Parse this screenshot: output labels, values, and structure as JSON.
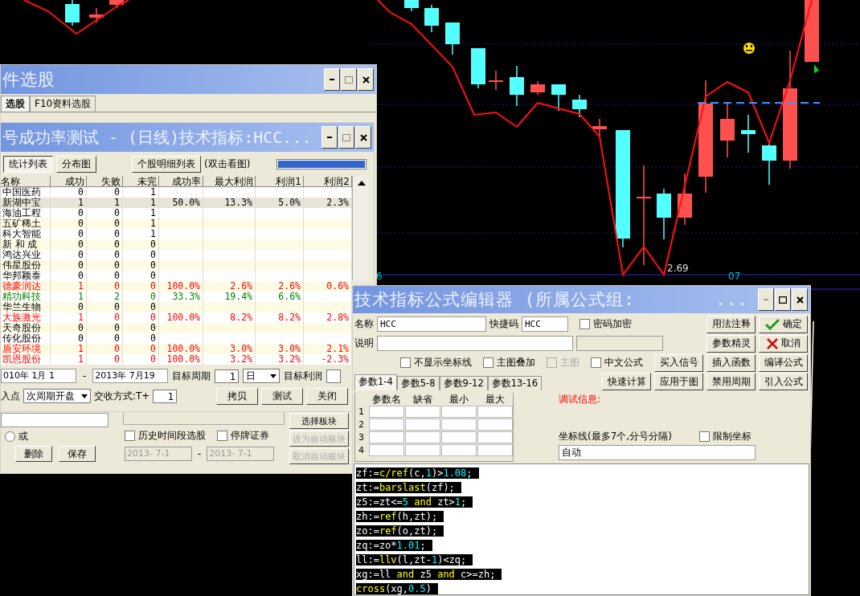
{
  "chart": {
    "price_label": "2.69",
    "axis_labels": [
      "6",
      "07"
    ]
  },
  "selector_window": {
    "title": "件选股",
    "tabs": [
      {
        "label": "选股",
        "selected": true
      },
      {
        "label": "F10资料选股",
        "selected": false
      }
    ],
    "radio": {
      "label": "或",
      "selected": false
    },
    "buttons": [
      "删除",
      "保存"
    ],
    "checkboxes": [
      {
        "label": "历史时间段选股",
        "checked": false
      },
      {
        "label": "停牌证券",
        "checked": false
      }
    ],
    "date_from": "2013- 7-1",
    "date_sep": "-",
    "date_to": "2013- 7-1",
    "block_buttons": [
      {
        "label": "选择板块",
        "disabled": false
      },
      {
        "label": "设为自动板块",
        "disabled": true
      },
      {
        "label": "取消自动板块",
        "disabled": true
      }
    ]
  },
  "test_window": {
    "title": "号成功率测试 - (日线)技术指标:HCC...",
    "view_buttons": [
      {
        "label": "统计列表",
        "selected": true
      },
      {
        "label": "分布图",
        "selected": false
      }
    ],
    "detail_button": "个股明细列表",
    "hint": "(双击看图)",
    "progress": {
      "level": 1
    },
    "columns": [
      "名称",
      "成功",
      "失败",
      "未完",
      "成功率",
      "最大利润",
      "利润1",
      "利润2"
    ],
    "rows": [
      {
        "cells": [
          "中国医药",
          "0",
          "0",
          "1",
          "",
          "",
          "",
          ""
        ],
        "color": "#000000",
        "selected": false
      },
      {
        "cells": [
          "新湖中宝",
          "1",
          "1",
          "1",
          "50.0%",
          "13.3%",
          "5.0%",
          "2.3%"
        ],
        "color": "#000000",
        "selected": true
      },
      {
        "cells": [
          "海油工程",
          "0",
          "0",
          "1",
          "",
          "",
          "",
          ""
        ],
        "color": "#000000",
        "selected": false
      },
      {
        "cells": [
          "五矿稀土",
          "0",
          "0",
          "1",
          "",
          "",
          "",
          ""
        ],
        "color": "#000000",
        "selected": false
      },
      {
        "cells": [
          "科大智能",
          "0",
          "0",
          "1",
          "",
          "",
          "",
          ""
        ],
        "color": "#000000",
        "selected": false
      },
      {
        "cells": [
          "新 和 成",
          "0",
          "0",
          "0",
          "",
          "",
          "",
          ""
        ],
        "color": "#000000",
        "selected": false
      },
      {
        "cells": [
          "鸿达兴业",
          "0",
          "0",
          "0",
          "",
          "",
          "",
          ""
        ],
        "color": "#000000",
        "selected": false
      },
      {
        "cells": [
          "伟星股份",
          "0",
          "0",
          "0",
          "",
          "",
          "",
          ""
        ],
        "color": "#000000",
        "selected": false
      },
      {
        "cells": [
          "华邦颖泰",
          "0",
          "0",
          "0",
          "",
          "",
          "",
          ""
        ],
        "color": "#000000",
        "selected": false
      },
      {
        "cells": [
          "德豪润达",
          "1",
          "0",
          "0",
          "100.0%",
          "2.6%",
          "2.6%",
          "0.6%"
        ],
        "color": "#ff0000",
        "selected": false
      },
      {
        "cells": [
          "精功科技",
          "1",
          "2",
          "0",
          "33.3%",
          "19.4%",
          "6.6%",
          ""
        ],
        "color": "#008000",
        "selected": false
      },
      {
        "cells": [
          "华兰生物",
          "0",
          "0",
          "0",
          "",
          "",
          "",
          ""
        ],
        "color": "#000000",
        "selected": false
      },
      {
        "cells": [
          "大族激光",
          "1",
          "0",
          "0",
          "100.0%",
          "8.2%",
          "8.2%",
          "2.8%"
        ],
        "color": "#ff0000",
        "selected": false
      },
      {
        "cells": [
          "天奇股份",
          "0",
          "0",
          "0",
          "",
          "",
          "",
          ""
        ],
        "color": "#000000",
        "selected": false
      },
      {
        "cells": [
          "传化股份",
          "0",
          "0",
          "0",
          "",
          "",
          "",
          ""
        ],
        "color": "#000000",
        "selected": false
      },
      {
        "cells": [
          "盾安环境",
          "1",
          "0",
          "0",
          "100.0%",
          "3.0%",
          "3.0%",
          "2.1%"
        ],
        "color": "#ff0000",
        "selected": false
      },
      {
        "cells": [
          "凯恩股份",
          "1",
          "0",
          "0",
          "100.0%",
          "3.2%",
          "3.2%",
          "-2.3%"
        ],
        "color": "#ff0000",
        "selected": false
      }
    ],
    "date_from": "010年 1月 1",
    "date_sep": "-",
    "date_to": "2013年 7月19",
    "period_label": "目标周期",
    "period_value": "1",
    "period_unit": "日",
    "profit_label": "目标利润",
    "entry_label": "入点",
    "entry_value": "次周期开盘",
    "settle_label": "交收方式:T+",
    "settle_value": "1",
    "action_buttons": [
      "拷贝",
      "测试",
      "关闭"
    ]
  },
  "editor_window": {
    "title": "技术指标公式编辑器 (所属公式组:",
    "title_tail": "...",
    "name_label": "名称",
    "name_value": "HCC",
    "shortcut_label": "快捷码",
    "shortcut_value": "HCC",
    "password": {
      "label": "密码加密",
      "checked": false
    },
    "desc_label": "说明",
    "options": [
      {
        "label": "不显示坐标线",
        "checked": false,
        "disabled": false
      },
      {
        "label": "主图叠加",
        "checked": false,
        "disabled": false
      },
      {
        "label": "主图",
        "checked": false,
        "disabled": true
      },
      {
        "label": "中文公式",
        "checked": false,
        "disabled": false
      }
    ],
    "buttons": [
      {
        "label": "用法注释",
        "kind": "plain"
      },
      {
        "label": "确定",
        "kind": "ok"
      },
      {
        "label": "参数精灵",
        "kind": "plain"
      },
      {
        "label": "取消",
        "kind": "cancel"
      },
      {
        "label": "买入信号",
        "kind": "plain"
      },
      {
        "label": "插入函数",
        "kind": "plain"
      },
      {
        "label": "编译公式",
        "kind": "plain"
      },
      {
        "label": "快速计算",
        "kind": "plain"
      },
      {
        "label": "应用于图",
        "kind": "plain"
      },
      {
        "label": "禁用周期",
        "kind": "plain"
      },
      {
        "label": "引入公式",
        "kind": "plain"
      }
    ],
    "param_tabs": [
      {
        "label": "参数1-4",
        "selected": true
      },
      {
        "label": "参数5-8",
        "selected": false
      },
      {
        "label": "参数9-12",
        "selected": false
      },
      {
        "label": "参数13-16",
        "selected": false
      }
    ],
    "param_columns": [
      "参数名",
      "缺省",
      "最小",
      "最大"
    ],
    "param_rows": [
      "1",
      "2",
      "3",
      "4"
    ],
    "debug_label": "调试信息:",
    "axis_label": "坐标线(最多7个,分号分隔)",
    "limit": {
      "label": "限制坐标",
      "checked": false
    },
    "axis_value": "自动",
    "code": [
      [
        {
          "text": "zf:=",
          "kind": "plain"
        },
        {
          "text": "c/ref",
          "kind": "func"
        },
        {
          "text": "(c,",
          "kind": "plain"
        },
        {
          "text": "1",
          "kind": "num"
        },
        {
          "text": ")>",
          "kind": "plain"
        },
        {
          "text": "1.08",
          "kind": "num"
        },
        {
          "text": ";",
          "kind": "plain"
        }
      ],
      [
        {
          "text": "zt:=",
          "kind": "plain"
        },
        {
          "text": "barslast",
          "kind": "func"
        },
        {
          "text": "(zf);",
          "kind": "plain"
        }
      ],
      [
        {
          "text": "z5:=zt<=",
          "kind": "plain"
        },
        {
          "text": "5",
          "kind": "num"
        },
        {
          "text": " and ",
          "kind": "func"
        },
        {
          "text": "zt>",
          "kind": "plain"
        },
        {
          "text": "1",
          "kind": "num"
        },
        {
          "text": ";",
          "kind": "plain"
        }
      ],
      [
        {
          "text": "zh:=",
          "kind": "plain"
        },
        {
          "text": "ref",
          "kind": "func"
        },
        {
          "text": "(h,zt);",
          "kind": "plain"
        }
      ],
      [
        {
          "text": "zo:=",
          "kind": "plain"
        },
        {
          "text": "ref",
          "kind": "func"
        },
        {
          "text": "(o,zt);",
          "kind": "plain"
        }
      ],
      [
        {
          "text": "zq:=zo*",
          "kind": "plain"
        },
        {
          "text": "1.01",
          "kind": "num"
        },
        {
          "text": ";",
          "kind": "plain"
        }
      ],
      [
        {
          "text": "ll:=",
          "kind": "plain"
        },
        {
          "text": "llv",
          "kind": "func"
        },
        {
          "text": "(l,zt-",
          "kind": "plain"
        },
        {
          "text": "1",
          "kind": "num"
        },
        {
          "text": ")<zq;",
          "kind": "plain"
        }
      ],
      [
        {
          "text": "xg:=ll",
          "kind": "plain"
        },
        {
          "text": " and ",
          "kind": "func"
        },
        {
          "text": "z5",
          "kind": "plain"
        },
        {
          "text": " and ",
          "kind": "func"
        },
        {
          "text": "c>=zh;",
          "kind": "plain"
        }
      ],
      [
        {
          "text": "cross",
          "kind": "func"
        },
        {
          "text": "(xg,",
          "kind": "plain"
        },
        {
          "text": "0.5",
          "kind": "num"
        },
        {
          "text": ")",
          "kind": "plain"
        }
      ]
    ]
  }
}
